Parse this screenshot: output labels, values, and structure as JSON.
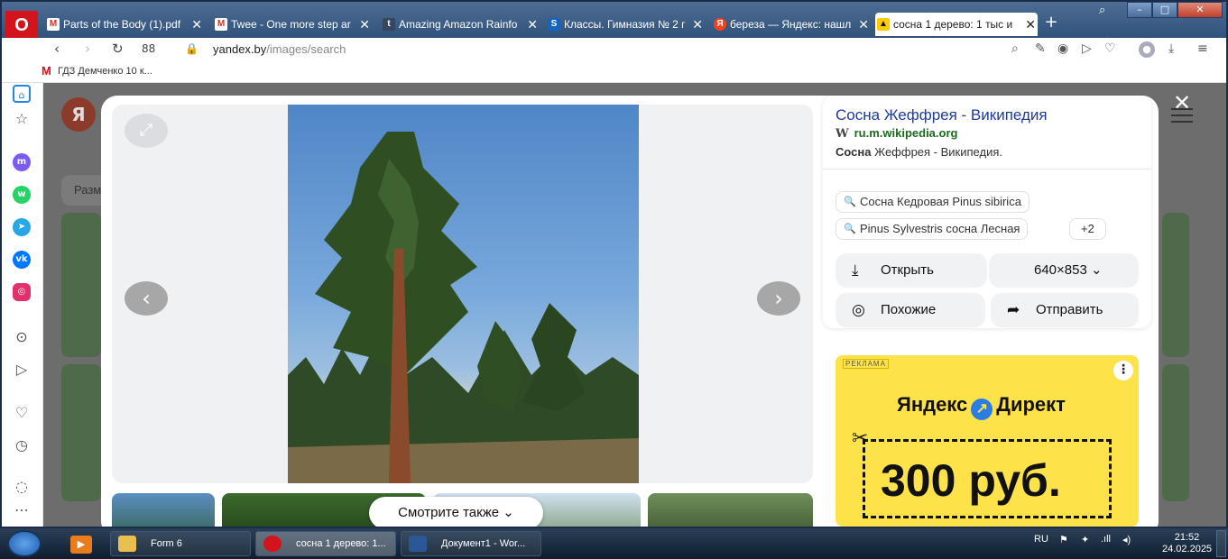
{
  "browser": {
    "tabs": [
      {
        "icon": "gmail-icon",
        "label": "Parts of the Body (1).pdf"
      },
      {
        "icon": "gmail-icon",
        "label": "Twee - One more step ar"
      },
      {
        "icon": "tumblr-icon",
        "label": "Amazing Amazon Rainfo"
      },
      {
        "icon": "s-icon",
        "label": "Классы. Гимназия № 2 г"
      },
      {
        "icon": "yandex-icon",
        "label": "береза — Яндекс: нашл"
      },
      {
        "icon": "images-icon",
        "label": "сосна 1 дерево: 1 тыс и"
      }
    ],
    "url_host": "yandex.by",
    "url_path": "/images/search",
    "bookmark": "ГДЗ Демченко 10 к..."
  },
  "viewer": {
    "see_also": "Смотрите также"
  },
  "panel": {
    "title": "Сосна Жеффрея - Википедия",
    "host": "ru.m.wikipedia.org",
    "desc_bold": "Сосна",
    "desc_rest": " Жеффрея - Википедия.",
    "chips": [
      "Сосна Кедровая Pinus sibirica",
      "Pinus Sylvestris сосна Лесная",
      "+2"
    ],
    "open_label": "Открыть",
    "size_label": "640×853",
    "similar_label": "Похожие",
    "share_label": "Отправить"
  },
  "ad": {
    "tag": "РЕКЛАМА",
    "brand_left": "Яндекс",
    "brand_right": "Директ",
    "price": "300 руб."
  },
  "background": {
    "search_partial": "Разм"
  },
  "taskbar": {
    "items": [
      "Form 6",
      "сосна 1 дерево: 1...",
      "Документ1 - Wor..."
    ],
    "lang": "RU",
    "time": "21:52",
    "date": "24.02.2025"
  },
  "colors": {
    "accent": "#d3141c",
    "link": "#1d3c9a",
    "host": "#1c6b1c",
    "ad_bg": "#fee24a"
  }
}
